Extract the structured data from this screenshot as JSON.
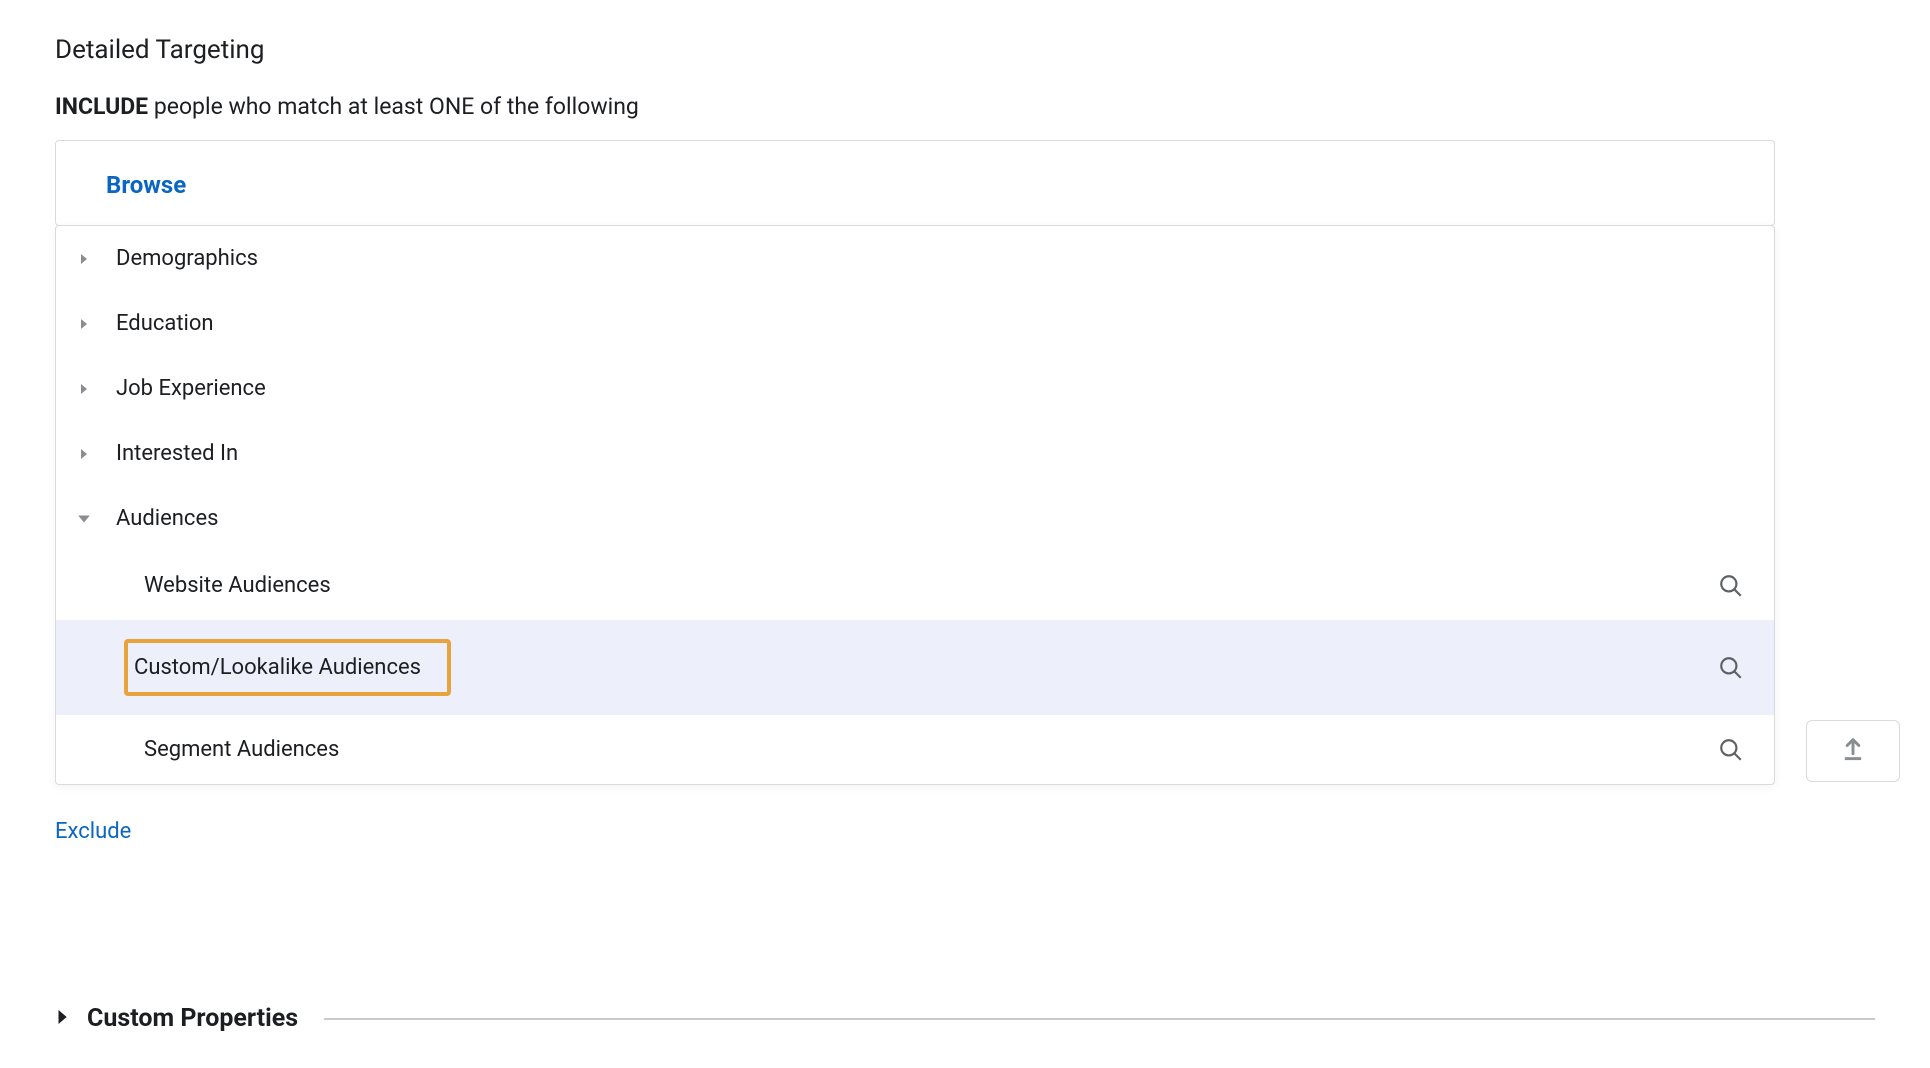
{
  "header": {
    "title": "Detailed Targeting",
    "include_bold": "INCLUDE",
    "include_rest": " people who match at least ONE of the following",
    "browse_label": "Browse"
  },
  "categories": [
    {
      "label": "Demographics",
      "expanded": false
    },
    {
      "label": "Education",
      "expanded": false
    },
    {
      "label": "Job Experience",
      "expanded": false
    },
    {
      "label": "Interested In",
      "expanded": false
    },
    {
      "label": "Audiences",
      "expanded": true,
      "children": [
        {
          "label": "Website Audiences",
          "highlighted": false
        },
        {
          "label": "Custom/Lookalike Audiences",
          "highlighted": true,
          "boxed": true
        },
        {
          "label": "Segment Audiences",
          "highlighted": false
        }
      ]
    }
  ],
  "exclude_label": "Exclude",
  "custom_properties_label": "Custom Properties"
}
